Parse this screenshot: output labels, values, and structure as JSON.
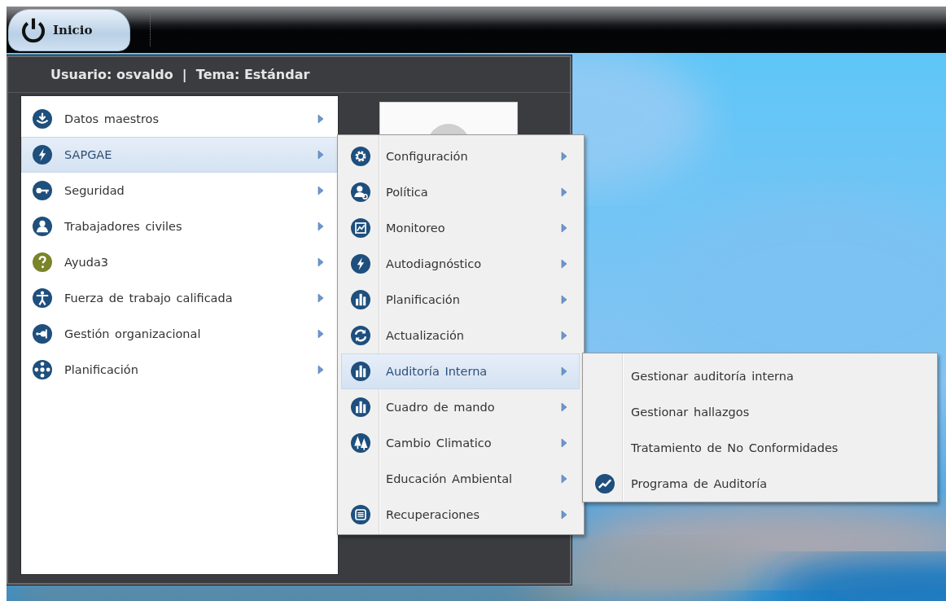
{
  "taskbar": {
    "start_button": "Inicio"
  },
  "start_menu": {
    "header": "Usuario: osvaldo  |  Tema: Estándar",
    "items": [
      {
        "label": "Datos maestros",
        "selected": false
      },
      {
        "label": "SAPGAE",
        "selected": true
      },
      {
        "label": "Seguridad",
        "selected": false
      },
      {
        "label": "Trabajadores civiles",
        "selected": false
      },
      {
        "label": "Ayuda3",
        "selected": false
      },
      {
        "label": "Fuerza de trabajo calificada",
        "selected": false
      },
      {
        "label": "Gestión organizacional",
        "selected": false
      },
      {
        "label": "Planificación",
        "selected": false
      }
    ]
  },
  "submenu": {
    "items": [
      {
        "label": "Configuración",
        "selected": false,
        "icon": true
      },
      {
        "label": "Política",
        "selected": false,
        "icon": true
      },
      {
        "label": "Monitoreo",
        "selected": false,
        "icon": true
      },
      {
        "label": "Autodiagnóstico",
        "selected": false,
        "icon": true
      },
      {
        "label": "Planificación",
        "selected": false,
        "icon": true
      },
      {
        "label": "Actualización",
        "selected": false,
        "icon": true
      },
      {
        "label": "Auditoría Interna",
        "selected": true,
        "icon": true
      },
      {
        "label": "Cuadro de mando",
        "selected": false,
        "icon": true
      },
      {
        "label": "Cambio Climatico",
        "selected": false,
        "icon": true
      },
      {
        "label": "Educación Ambiental",
        "selected": false,
        "icon": false
      },
      {
        "label": "Recuperaciones",
        "selected": false,
        "icon": true
      }
    ]
  },
  "submenu_2": {
    "items": [
      {
        "label": "Gestionar auditoría interna",
        "icon": false
      },
      {
        "label": "Gestionar hallazgos",
        "icon": false
      },
      {
        "label": "Tratamiento de No Conformidades",
        "icon": false
      },
      {
        "label": "Programa de Auditoría",
        "icon": true
      }
    ]
  }
}
